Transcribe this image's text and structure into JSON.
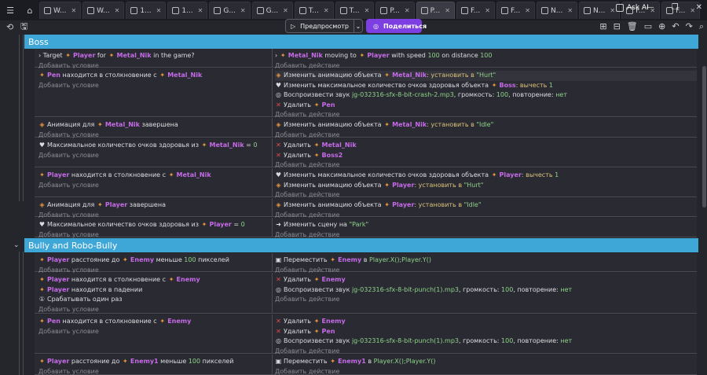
{
  "tabs": [
    {
      "label": "W...",
      "icon": "page-icon"
    },
    {
      "label": "W...",
      "icon": "events-icon"
    },
    {
      "label": "1...",
      "icon": "scene-icon"
    },
    {
      "label": "1...",
      "icon": "events-icon"
    },
    {
      "label": "G...",
      "icon": "scene-icon"
    },
    {
      "label": "G...",
      "icon": "events-icon"
    },
    {
      "label": "T...",
      "icon": "scene-icon"
    },
    {
      "label": "T...",
      "icon": "events-icon"
    },
    {
      "label": "P...",
      "icon": "scene-icon"
    },
    {
      "label": "P...",
      "icon": "events-icon",
      "active": true
    },
    {
      "label": "F...",
      "icon": "events-icon"
    },
    {
      "label": "F...",
      "icon": "events-icon"
    },
    {
      "label": "N...",
      "icon": "scene-icon"
    },
    {
      "label": "N...",
      "icon": "events-icon"
    },
    {
      "label": "F...",
      "icon": "scene-icon"
    },
    {
      "label": "F...",
      "icon": "events-icon"
    }
  ],
  "askai": "Ask AI",
  "toolbar": {
    "preview": "Предпросмотр",
    "share": "Поделиться"
  },
  "groups": [
    {
      "title": "Boss"
    },
    {
      "title": "Bully and Robo-Bully"
    }
  ],
  "add_condition": "Добавить условие",
  "add_action": "Добавить действие",
  "events": [
    {
      "conditions": [
        [
          "› ",
          "Target ",
          {
            "o": "Player"
          },
          " for ",
          {
            "o": "Metal_Nik"
          },
          " in the game?"
        ]
      ],
      "actions": [
        [
          "› ",
          {
            "o": "Metal_Nik"
          },
          " moving to ",
          {
            "o": "Player"
          },
          " with speed ",
          {
            "n": "100"
          },
          " on distance ",
          {
            "n": "100"
          }
        ]
      ]
    },
    {
      "conditions": [
        [
          {
            "o": "Pen"
          },
          " находится в столкновение с ",
          {
            "o": "Metal_Nik"
          }
        ]
      ],
      "actions": [
        [
          "Изменить анимацию объекта ",
          {
            "o": "Metal_Nik"
          },
          {
            "p": ": установить в "
          },
          {
            "s": "\"Hurt\""
          }
        ],
        [
          "Изменить максимальное количество очков здоровья объекта ",
          {
            "o": "Boss"
          },
          {
            "p": ": вычесть "
          },
          {
            "n": "1"
          }
        ],
        [
          "Воспроизвести звук ",
          {
            "s": "jg-032316-sfx-8-bit-crash-2.mp3"
          },
          ", громкость: ",
          {
            "n": "100"
          },
          ", повторение: ",
          {
            "s": "нет"
          }
        ],
        [
          "Удалить ",
          {
            "o": "Pen"
          }
        ]
      ]
    },
    {
      "conditions": [
        [
          "Анимация для ",
          {
            "o": "Metal_Nik"
          },
          " завершена"
        ]
      ],
      "actions": [
        [
          "Изменить анимацию объекта ",
          {
            "o": "Metal_Nik"
          },
          {
            "p": ": установить в "
          },
          {
            "s": "\"Idle\""
          }
        ]
      ]
    },
    {
      "conditions": [
        [
          "Максимальное количество очков здоровья из ",
          {
            "o": "Metal_Nik"
          },
          " = ",
          {
            "n": "0"
          }
        ]
      ],
      "actions": [
        [
          "Удалить ",
          {
            "o": "Metal_Nik"
          }
        ],
        [
          "Удалить ",
          {
            "o": "Boss2"
          }
        ]
      ]
    },
    {
      "conditions": [
        [
          {
            "o": "Player"
          },
          " находится в столкновение с ",
          {
            "o": "Metal_Nik"
          }
        ]
      ],
      "actions": [
        [
          "Изменить максимальное количество очков здоровья объекта ",
          {
            "o": "Player"
          },
          {
            "p": ": вычесть "
          },
          {
            "n": "1"
          }
        ],
        [
          "Изменить анимацию объекта ",
          {
            "o": "Player"
          },
          {
            "p": ": установить в "
          },
          {
            "s": "\"Hurt\""
          }
        ]
      ]
    },
    {
      "conditions": [
        [
          "Анимация для ",
          {
            "o": "Player"
          },
          " завершена"
        ]
      ],
      "actions": [
        [
          "Изменить анимацию объекта ",
          {
            "o": "Player"
          },
          {
            "p": ": установить в "
          },
          {
            "s": "\"Idle\""
          }
        ]
      ]
    },
    {
      "conditions": [
        [
          "Максимальное количество очков здоровья из ",
          {
            "o": "Player"
          },
          " = ",
          {
            "n": "0"
          }
        ]
      ],
      "actions": [
        [
          "Изменить сцену на ",
          {
            "s": "\"Park\""
          }
        ]
      ]
    },
    {
      "conditions": [
        [
          {
            "o": "Player"
          },
          " расстояние до ",
          {
            "o": "Enemy"
          },
          " меньше ",
          {
            "n": "100"
          },
          " пикселей"
        ]
      ],
      "actions": [
        [
          "Переместить ",
          {
            "o": "Enemy"
          },
          " в ",
          {
            "s": "Player.X();Player.Y()"
          }
        ]
      ]
    },
    {
      "conditions": [
        [
          {
            "o": "Player"
          },
          " находится в столкновение с ",
          {
            "o": "Enemy"
          }
        ],
        [
          {
            "o": "Player"
          },
          " находится в падении"
        ],
        [
          "Срабатывать один раз"
        ]
      ],
      "actions": [
        [
          "Удалить ",
          {
            "o": "Enemy"
          }
        ],
        [
          "Воспроизвести звук ",
          {
            "s": "jg-032316-sfx-8-bit-punch(1).mp3"
          },
          ", громкость: ",
          {
            "n": "100"
          },
          ", повторение: ",
          {
            "s": "нет"
          }
        ]
      ]
    },
    {
      "conditions": [
        [
          {
            "o": "Pen"
          },
          " находится в столкновение с ",
          {
            "o": "Enemy"
          }
        ]
      ],
      "actions": [
        [
          "Удалить ",
          {
            "o": "Enemy"
          }
        ],
        [
          "Удалить ",
          {
            "o": "Pen"
          }
        ],
        [
          "Воспроизвести звук ",
          {
            "s": "jg-032316-sfx-8-bit-punch(1).mp3"
          },
          ", громкость: ",
          {
            "n": "100"
          },
          ", повторение: ",
          {
            "s": "нет"
          }
        ]
      ]
    },
    {
      "conditions": [
        [
          {
            "o": "Player"
          },
          " расстояние до ",
          {
            "o": "Enemy1"
          },
          " меньше ",
          {
            "n": "100"
          },
          " пикселей"
        ]
      ],
      "actions": [
        [
          "Переместить ",
          {
            "o": "Enemy1"
          },
          " в ",
          {
            "s": "Player.X();Player.Y()"
          }
        ]
      ]
    }
  ]
}
